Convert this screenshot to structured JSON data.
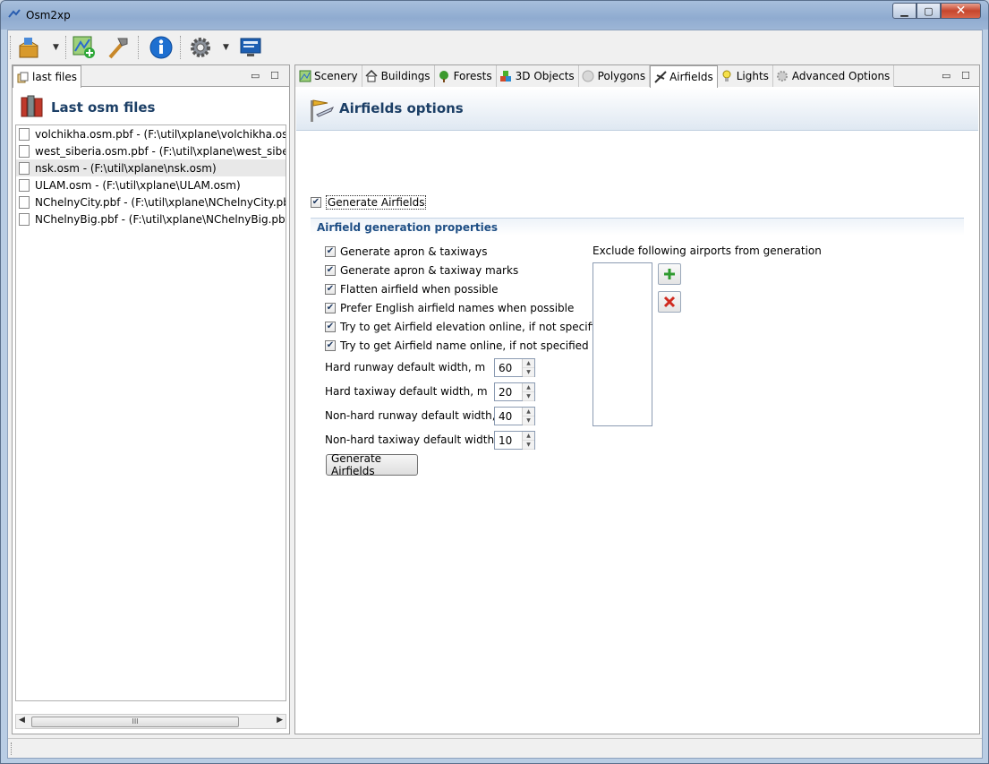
{
  "window": {
    "title": "Osm2xp"
  },
  "toolbar": {
    "items": [
      "open-project-icon",
      "new-scenery-icon",
      "build-tools-icon",
      "info-icon",
      "settings-icon",
      "monitor-icon"
    ]
  },
  "left_view": {
    "tab_label": "last files",
    "header": "Last osm files",
    "files": [
      "volchikha.osm.pbf  -  (F:\\util\\xplane\\volchikha.osm.pbf)",
      "west_siberia.osm.pbf  -  (F:\\util\\xplane\\west_siberia.osm.pbf)",
      "nsk.osm  -  (F:\\util\\xplane\\nsk.osm)",
      "ULAM.osm  -  (F:\\util\\xplane\\ULAM.osm)",
      "NChelnyCity.pbf  -  (F:\\util\\xplane\\NChelnyCity.pbf)",
      "NChelnyBig.pbf  -  (F:\\util\\xplane\\NChelnyBig.pbf)"
    ],
    "selected_index": 2,
    "scroll_thumb": "III"
  },
  "tabs": [
    {
      "label": "Scenery",
      "icon": "scenery-icon"
    },
    {
      "label": "Buildings",
      "icon": "house-icon"
    },
    {
      "label": "Forests",
      "icon": "tree-icon"
    },
    {
      "label": "3D Objects",
      "icon": "objects-icon"
    },
    {
      "label": "Polygons",
      "icon": "polygon-icon"
    },
    {
      "label": "Airfields",
      "icon": "airfield-icon",
      "active": true
    },
    {
      "label": "Lights",
      "icon": "bulb-icon"
    },
    {
      "label": "Advanced Options",
      "icon": "gear-icon"
    }
  ],
  "airfields": {
    "header": "Airfields options",
    "generate_label": "Generate Airfields",
    "section_title": "Airfield generation properties",
    "options": [
      "Generate apron & taxiways",
      "Generate apron & taxiway marks",
      "Flatten airfield when possible",
      "Prefer English airfield names when possible",
      "Try to get Airfield elevation online, if not specified",
      "Try to get Airfield name online, if not specified"
    ],
    "widths": [
      {
        "label": "Hard runway default width, m",
        "value": "60"
      },
      {
        "label": "Hard taxiway default width, m",
        "value": "20"
      },
      {
        "label": "Non-hard runway default width, m",
        "value": "40"
      },
      {
        "label": "Non-hard taxiway default width, m",
        "value": "10"
      }
    ],
    "generate_button": "Generate Airfields",
    "exclude_label": "Exclude following airports from generation"
  },
  "colors": {
    "header_text": "#1c3f66",
    "section_text": "#1f4f85"
  }
}
